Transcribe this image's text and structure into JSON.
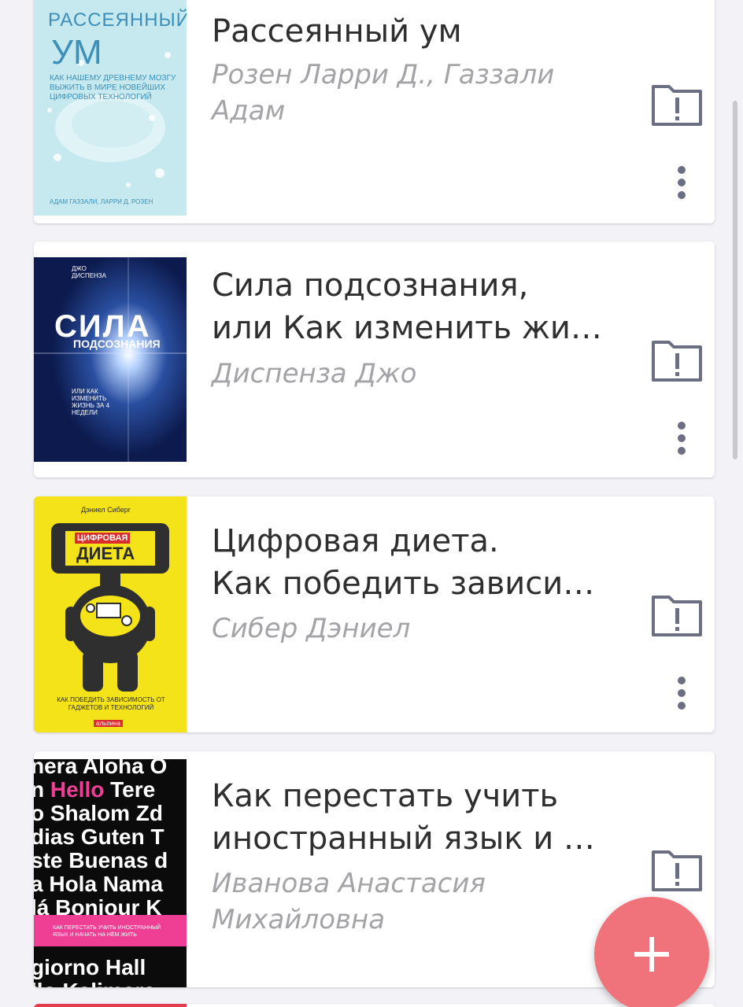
{
  "books": [
    {
      "title": "Рассеянный ум",
      "author": "Розен Ларри Д., Газзали\nАдам",
      "cover": {
        "heading_line1": "РАССЕЯННЫЙ",
        "heading_line2": "УМ",
        "subtitle": "КАК НАШЕМУ ДРЕВНЕМУ МОЗГУ ВЫЖИТЬ В МИРЕ НОВЕЙШИХ ЦИФРОВЫХ ТЕХНОЛОГИЙ",
        "authors": "АДАМ ГАЗЗАЛИ, ЛАРРИ Д. РОЗЕН"
      },
      "colors": {
        "cover_bg": "#c6e9ef",
        "cover_text": "#3c8fb8"
      }
    },
    {
      "title": "Сила подсознания,\nили Как изменить жи…",
      "author": "Диспенза Джо",
      "cover": {
        "author": "ДЖО ДИСПЕНЗА",
        "heading_line1": "СИЛА",
        "heading_line2": "ПОДСОЗНАНИЯ",
        "subtitle": "ИЛИ КАК ИЗМЕНИТЬ ЖИЗНЬ ЗА 4 НЕДЕЛИ"
      },
      "colors": {
        "cover_bg": "#0c1a4d",
        "cover_text": "#ffffff"
      }
    },
    {
      "title": "Цифровая диета.\nКак победить зависи…",
      "author": "Сибер Дэниел",
      "cover": {
        "author": "Дэниел Сиберг",
        "heading_line1": "ЦИФРОВАЯ",
        "heading_line2": "ДИЕТА",
        "subtitle": "КАК ПОБЕДИТЬ ЗАВИСИМОСТЬ ОТ ГАДЖЕТОВ И ТЕХНОЛОГИЙ",
        "publisher": "альпина"
      },
      "colors": {
        "cover_bg": "#f4e318",
        "cover_text": "#2a2a2a"
      }
    },
    {
      "title": "Как перестать учить\nиностранный язык и …",
      "author": "Иванова Анастасия\nМихайловна",
      "cover": {
        "words": [
          "nera Aloha O",
          "n Hello Tere",
          "o Shalom Zd",
          "dias Guten T",
          "ste Buenas d",
          "a Hola Nama",
          "lá Bonjour K",
          "giorno Hall",
          "llo Kalimera"
        ],
        "band_text": "КАК ПЕРЕСТАТЬ УЧИТЬ ИНОСТРАННЫЙ ЯЗЫК И НАЧАТЬ НА НЁМ ЖИТЬ"
      },
      "colors": {
        "cover_bg": "#0b0b0b",
        "cover_text": "#ffffff",
        "accent": "#ee3f95"
      }
    }
  ],
  "icons": {
    "folder": "folder-alert-icon",
    "more": "more-vertical-icon",
    "fab": "plus-icon"
  },
  "colors": {
    "background": "#f3f2f7",
    "card": "#ffffff",
    "title_text": "#2f2f2f",
    "author_text": "#a4a4a8",
    "icon_gray": "#6c6f82",
    "fab": "#f0727a"
  }
}
